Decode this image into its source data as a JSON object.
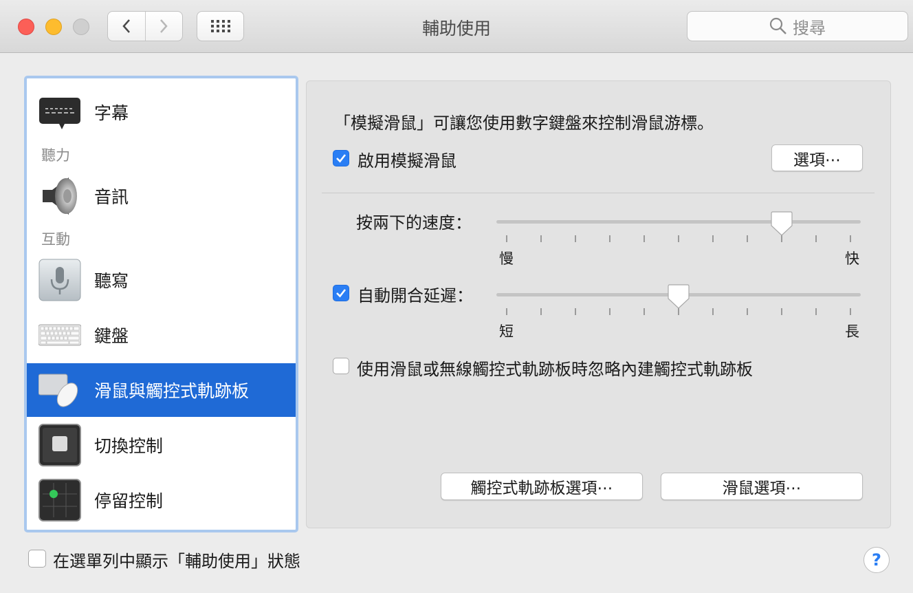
{
  "window": {
    "title": "輔助使用",
    "search_placeholder": "搜尋"
  },
  "sidebar": {
    "items": [
      {
        "label": "字幕",
        "icon": "captions-icon"
      },
      {
        "header": "聽力"
      },
      {
        "label": "音訊",
        "icon": "speaker-icon"
      },
      {
        "header": "互動"
      },
      {
        "label": "聽寫",
        "icon": "microphone-icon"
      },
      {
        "label": "鍵盤",
        "icon": "keyboard-icon"
      },
      {
        "label": "滑鼠與觸控式軌跡板",
        "icon": "mouse-trackpad-icon",
        "selected": true
      },
      {
        "label": "切換控制",
        "icon": "switch-control-icon"
      },
      {
        "label": "停留控制",
        "icon": "dwell-control-icon"
      }
    ]
  },
  "main": {
    "description": "「模擬滑鼠」可讓您使用數字鍵盤來控制滑鼠游標。",
    "enable_mouse_keys": {
      "label": "啟用模擬滑鼠",
      "checked": true
    },
    "options_button": "選項⋯",
    "double_click_speed": {
      "label": "按兩下的速度：",
      "min_label": "慢",
      "max_label": "快",
      "value": 0.8
    },
    "spring_loading": {
      "label": "自動開合延遲：",
      "checked": true,
      "min_label": "短",
      "max_label": "長",
      "value": 0.5
    },
    "ignore_trackpad": {
      "label": "使用滑鼠或無線觸控式軌跡板時忽略內建觸控式軌跡板",
      "checked": false
    },
    "trackpad_options_button": "觸控式軌跡板選項⋯",
    "mouse_options_button": "滑鼠選項⋯"
  },
  "footer": {
    "show_in_menubar": {
      "label": "在選單列中顯示「輔助使用」狀態",
      "checked": false
    },
    "help": "?"
  },
  "colors": {
    "accent": "#2a7ef4",
    "selection": "#1f6ad6"
  }
}
